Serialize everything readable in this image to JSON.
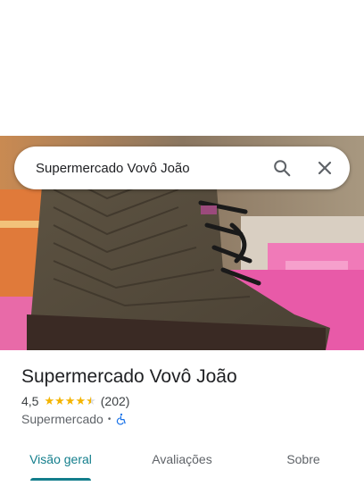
{
  "search": {
    "query": "Supermercado Vovô João"
  },
  "place": {
    "name": "Supermercado Vovô João",
    "rating": "4,5",
    "reviews_count": "(202)",
    "category": "Supermercado",
    "separator": "•",
    "star_fill": 4.5
  },
  "tabs": [
    {
      "label": "Visão geral",
      "active": true
    },
    {
      "label": "Avaliações",
      "active": false
    },
    {
      "label": "Sobre",
      "active": false
    }
  ],
  "colors": {
    "accent": "#137e8c",
    "star": "#f4b400",
    "accessibility": "#1a73e8"
  }
}
